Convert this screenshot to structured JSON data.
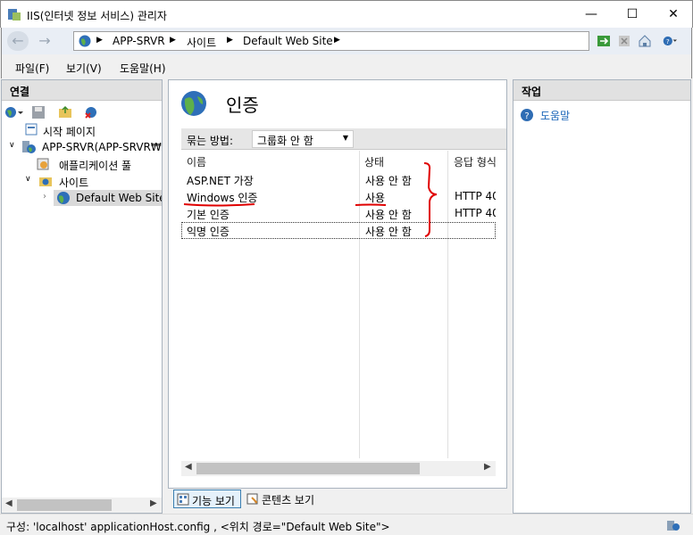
{
  "window": {
    "title": "IIS(인터넷 정보 서비스) 관리자"
  },
  "breadcrumb": [
    "APP-SRVR",
    "사이트",
    "Default Web Site"
  ],
  "menu": [
    "파일(F)",
    "보기(V)",
    "도움말(H)"
  ],
  "connections": {
    "header": "연결",
    "tree": [
      {
        "label": "시작 페이지",
        "level": 1
      },
      {
        "label": "APP-SRVR(APP-SRVR₩Ac",
        "level": 0
      },
      {
        "label": "애플리케이션 풀",
        "level": 1
      },
      {
        "label": "사이트",
        "level": 1
      },
      {
        "label": "Default Web Site",
        "level": 2,
        "selected": true
      }
    ]
  },
  "feature": {
    "title": "인증",
    "group_by_label": "묶는 방법:",
    "group_by_value": "그룹화 안 함",
    "columns": [
      "이름",
      "상태",
      "응답 형식"
    ],
    "rows": [
      {
        "name": "ASP.NET 가장",
        "status": "사용 안 함",
        "response": ""
      },
      {
        "name": "Windows 인증",
        "status": "사용",
        "response": "HTTP 40"
      },
      {
        "name": "기본 인증",
        "status": "사용 안 함",
        "response": "HTTP 40"
      },
      {
        "name": "익명 인증",
        "status": "사용 안 함",
        "response": ""
      }
    ]
  },
  "view_tabs": [
    "기능 보기",
    "콘텐츠 보기"
  ],
  "actions": {
    "header": "작업",
    "help": "도움말"
  },
  "status_bar": "구성: 'localhost' applicationHost.config , <위치 경로=\"Default Web Site\">",
  "colors": {
    "link": "#1a65b8",
    "annotation": "#e00000"
  }
}
